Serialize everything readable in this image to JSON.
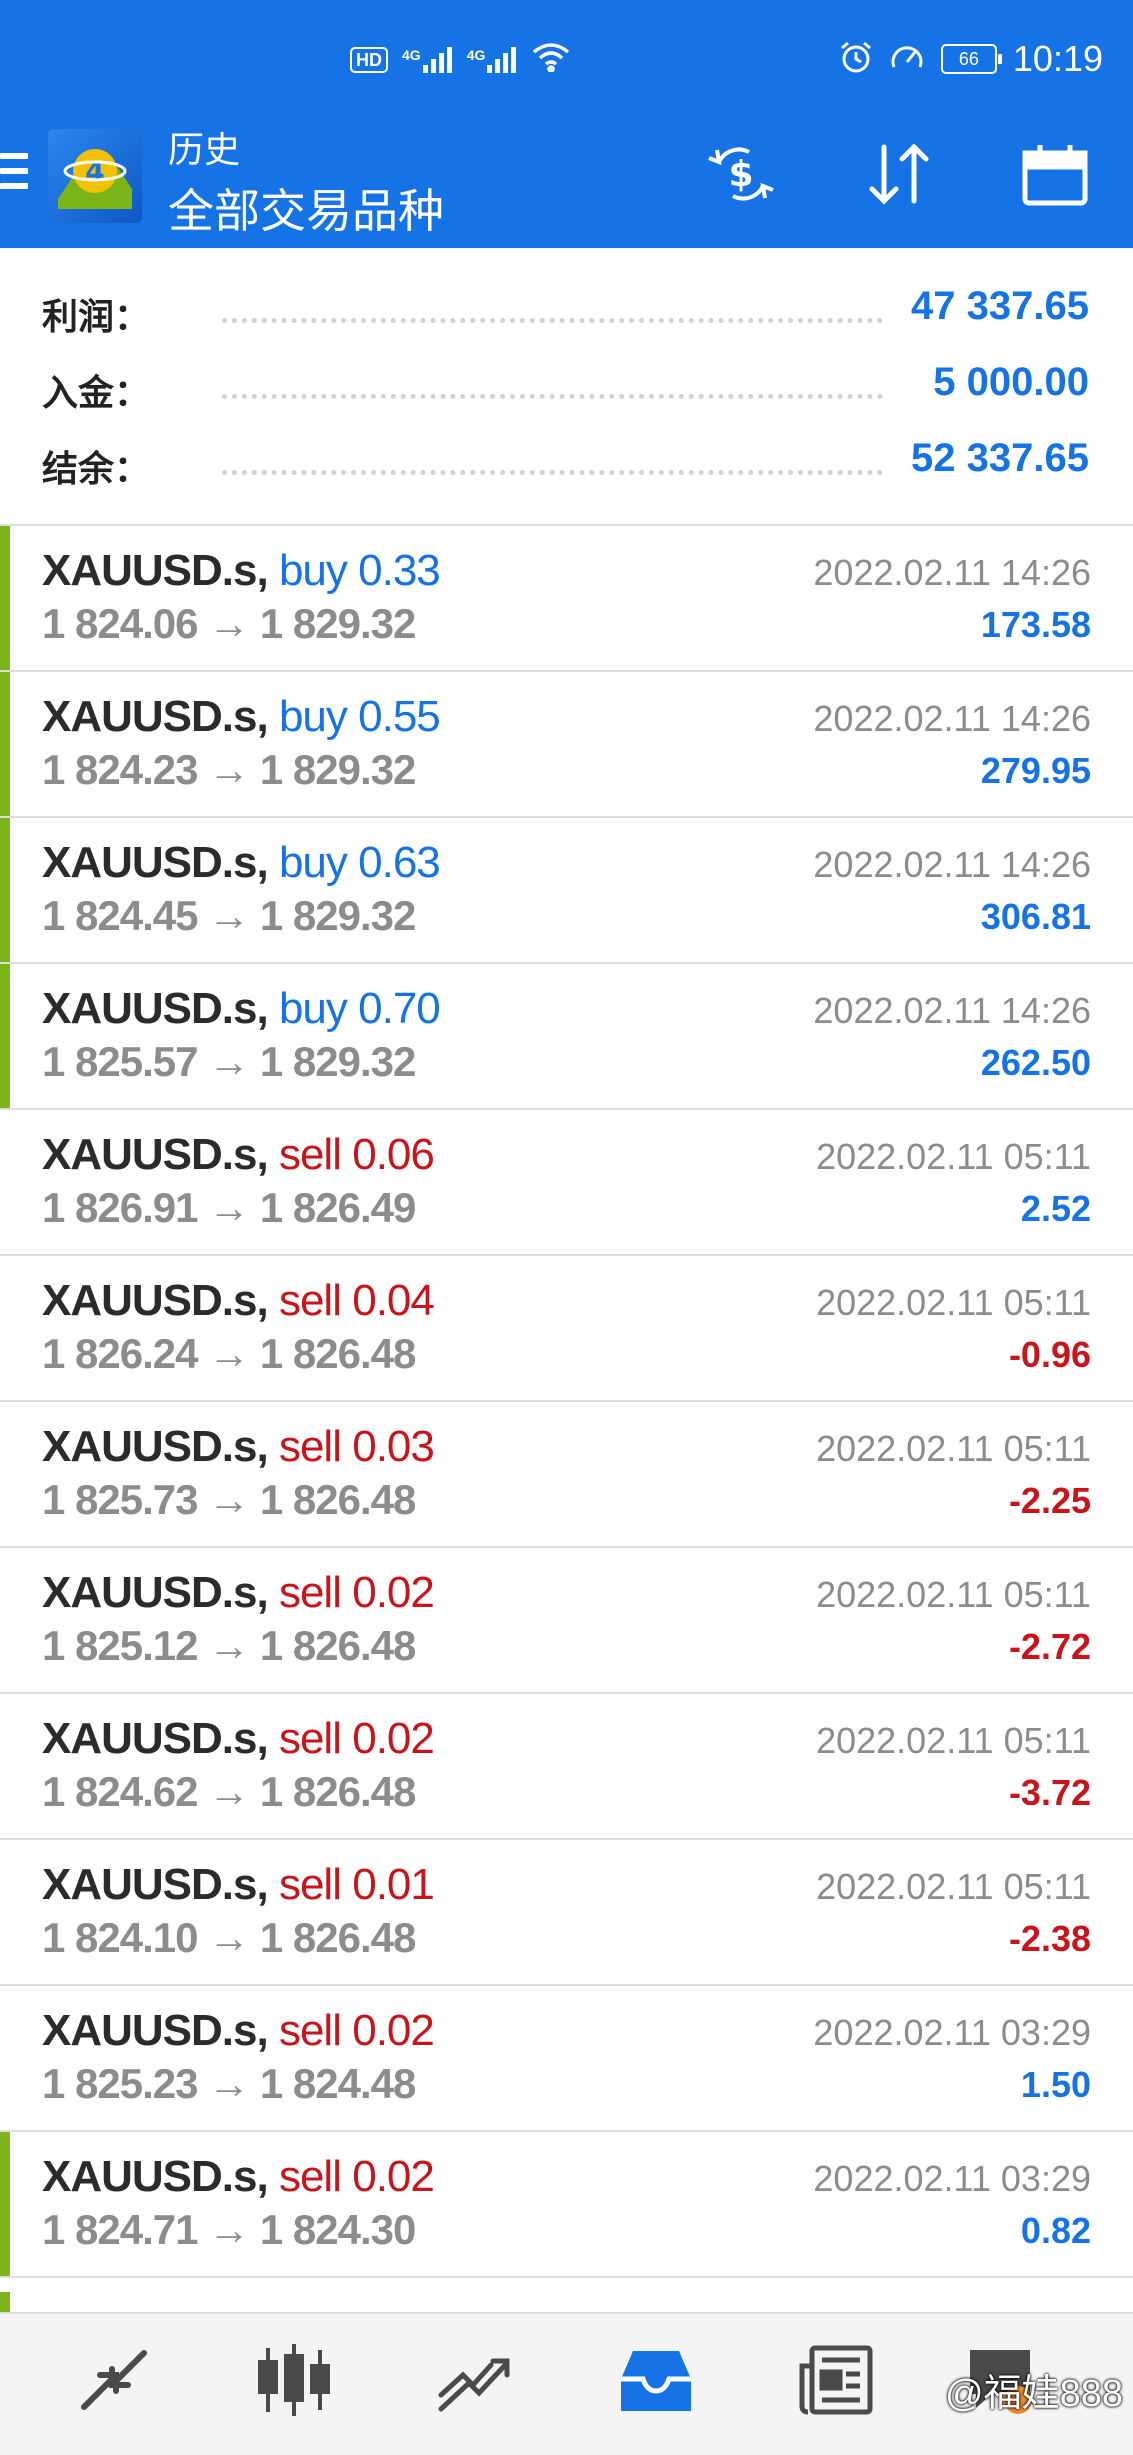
{
  "status": {
    "hd_label": "HD",
    "net1": "4G",
    "net2": "4G",
    "battery": "66",
    "time": "10:19"
  },
  "header": {
    "title": "历史",
    "subtitle": "全部交易品种"
  },
  "summary": [
    {
      "label": "利润：",
      "value": "47 337.65"
    },
    {
      "label": "入金：",
      "value": "5 000.00"
    },
    {
      "label": "结余：",
      "value": "52 337.65"
    }
  ],
  "trades": [
    {
      "symbol": "XAUUSD.s,",
      "side": "buy",
      "volume": "0.33",
      "open": "1 824.06",
      "close": "1 829.32",
      "time": "2022.02.11 14:26",
      "profit": "173.58",
      "marker": true
    },
    {
      "symbol": "XAUUSD.s,",
      "side": "buy",
      "volume": "0.55",
      "open": "1 824.23",
      "close": "1 829.32",
      "time": "2022.02.11 14:26",
      "profit": "279.95",
      "marker": true
    },
    {
      "symbol": "XAUUSD.s,",
      "side": "buy",
      "volume": "0.63",
      "open": "1 824.45",
      "close": "1 829.32",
      "time": "2022.02.11 14:26",
      "profit": "306.81",
      "marker": true
    },
    {
      "symbol": "XAUUSD.s,",
      "side": "buy",
      "volume": "0.70",
      "open": "1 825.57",
      "close": "1 829.32",
      "time": "2022.02.11 14:26",
      "profit": "262.50",
      "marker": true
    },
    {
      "symbol": "XAUUSD.s,",
      "side": "sell",
      "volume": "0.06",
      "open": "1 826.91",
      "close": "1 826.49",
      "time": "2022.02.11 05:11",
      "profit": "2.52",
      "marker": false
    },
    {
      "symbol": "XAUUSD.s,",
      "side": "sell",
      "volume": "0.04",
      "open": "1 826.24",
      "close": "1 826.48",
      "time": "2022.02.11 05:11",
      "profit": "-0.96",
      "marker": false
    },
    {
      "symbol": "XAUUSD.s,",
      "side": "sell",
      "volume": "0.03",
      "open": "1 825.73",
      "close": "1 826.48",
      "time": "2022.02.11 05:11",
      "profit": "-2.25",
      "marker": false
    },
    {
      "symbol": "XAUUSD.s,",
      "side": "sell",
      "volume": "0.02",
      "open": "1 825.12",
      "close": "1 826.48",
      "time": "2022.02.11 05:11",
      "profit": "-2.72",
      "marker": false
    },
    {
      "symbol": "XAUUSD.s,",
      "side": "sell",
      "volume": "0.02",
      "open": "1 824.62",
      "close": "1 826.48",
      "time": "2022.02.11 05:11",
      "profit": "-3.72",
      "marker": false
    },
    {
      "symbol": "XAUUSD.s,",
      "side": "sell",
      "volume": "0.01",
      "open": "1 824.10",
      "close": "1 826.48",
      "time": "2022.02.11 05:11",
      "profit": "-2.38",
      "marker": false
    },
    {
      "symbol": "XAUUSD.s,",
      "side": "sell",
      "volume": "0.02",
      "open": "1 825.23",
      "close": "1 824.48",
      "time": "2022.02.11 03:29",
      "profit": "1.50",
      "marker": false
    },
    {
      "symbol": "XAUUSD.s,",
      "side": "sell",
      "volume": "0.02",
      "open": "1 824.71",
      "close": "1 824.30",
      "time": "2022.02.11 03:29",
      "profit": "0.82",
      "marker": true
    }
  ],
  "arrow": "→",
  "nav": {
    "items": [
      "quotes-icon",
      "chart-candles-icon",
      "trade-icon",
      "history-icon",
      "news-icon",
      "chat-icon"
    ]
  },
  "watermark": "@福娃888",
  "colors": {
    "brand": "#1673e6",
    "profit_positive": "#1673e6",
    "profit_negative": "#c8141b",
    "buy": "#1673e6",
    "sell": "#c8141b",
    "marker": "#7cb518"
  }
}
